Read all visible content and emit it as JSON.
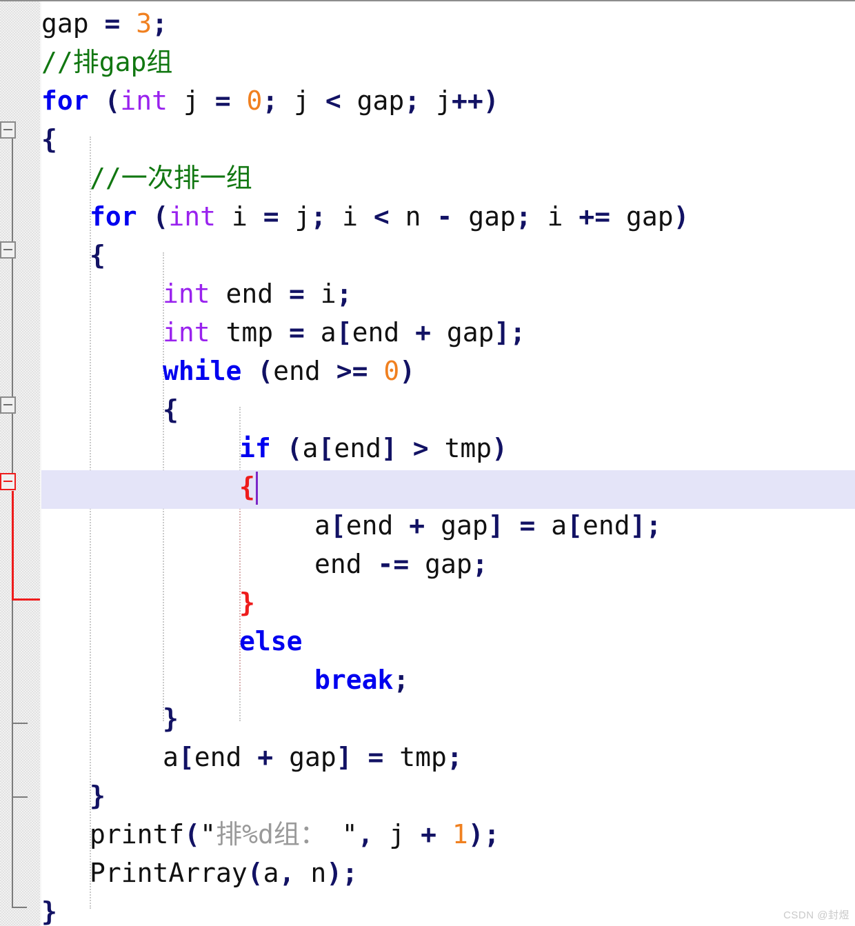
{
  "editor": {
    "language": "c",
    "active_line_number": 11,
    "cursor_column": 18,
    "colors": {
      "keyword": "#0000ef",
      "type": "#9922ee",
      "operator": "#121264",
      "number": "#f08020",
      "comment": "#117711",
      "string": "#9a9a9a",
      "plain": "#111111",
      "brace_matched": "#ee1c1c",
      "active_line_background": "#e4e4f8",
      "caret": "#7b27c8",
      "gutter_background": "#f2f2f2",
      "fold_line": "#7b7b7b",
      "indent_guide": "#c9c9c9"
    }
  },
  "gutter": {
    "fold_boxes": [
      {
        "name": "fold-box-for-j",
        "glyph": "-",
        "state": "expanded",
        "color": "#8a8a8a"
      },
      {
        "name": "fold-box-for-i",
        "glyph": "-",
        "state": "expanded",
        "color": "#8a8a8a"
      },
      {
        "name": "fold-box-while",
        "glyph": "-",
        "state": "expanded",
        "color": "#8a8a8a"
      },
      {
        "name": "fold-box-if",
        "glyph": "-",
        "state": "expanded",
        "color": "#ee1c1c"
      }
    ]
  },
  "code_lines": [
    {
      "n": 1,
      "indent": 0,
      "text": "gap = 3;"
    },
    {
      "n": 2,
      "indent": 0,
      "text": "//排gap组"
    },
    {
      "n": 3,
      "indent": 0,
      "text": "for (int j = 0; j < gap; j++)"
    },
    {
      "n": 4,
      "indent": 0,
      "text": "{"
    },
    {
      "n": 5,
      "indent": 1,
      "text": "//一次排一组"
    },
    {
      "n": 6,
      "indent": 1,
      "text": "for (int i = j; i < n - gap; i += gap)"
    },
    {
      "n": 7,
      "indent": 1,
      "text": "{"
    },
    {
      "n": 8,
      "indent": 2,
      "text": "int end = i;"
    },
    {
      "n": 9,
      "indent": 2,
      "text": "int tmp = a[end + gap];"
    },
    {
      "n": 10,
      "indent": 2,
      "text": "while (end >= 0)"
    },
    {
      "n": 11,
      "indent": 2,
      "text": "{"
    },
    {
      "n": 12,
      "indent": 3,
      "text": "if (a[end] > tmp)"
    },
    {
      "n": 13,
      "indent": 3,
      "text": "{"
    },
    {
      "n": 14,
      "indent": 4,
      "text": "a[end + gap] = a[end];"
    },
    {
      "n": 15,
      "indent": 4,
      "text": "end -= gap;"
    },
    {
      "n": 16,
      "indent": 3,
      "text": "}"
    },
    {
      "n": 17,
      "indent": 3,
      "text": "else"
    },
    {
      "n": 18,
      "indent": 4,
      "text": "break;"
    },
    {
      "n": 19,
      "indent": 2,
      "text": "}"
    },
    {
      "n": 20,
      "indent": 2,
      "text": "a[end + gap] = tmp;"
    },
    {
      "n": 21,
      "indent": 1,
      "text": "}"
    },
    {
      "n": 22,
      "indent": 1,
      "text": "printf(\"排%d组： \", j + 1);"
    },
    {
      "n": 23,
      "indent": 1,
      "text": "PrintArray(a, n);"
    },
    {
      "n": 24,
      "indent": 0,
      "text": "}"
    }
  ],
  "watermark": {
    "text": "CSDN @封煜"
  }
}
